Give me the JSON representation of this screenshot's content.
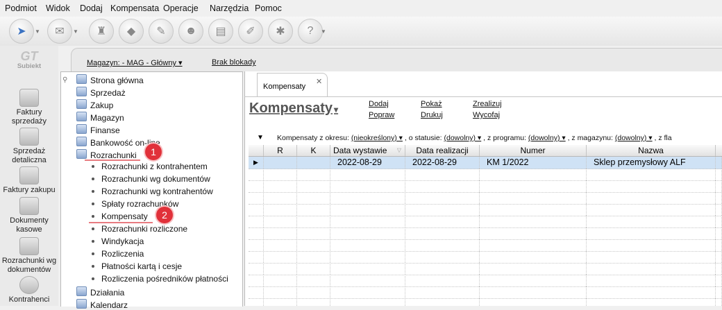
{
  "menu": [
    "Podmiot",
    "Widok",
    "Dodaj",
    "Kompensata",
    "Operacje",
    "Narzędzia",
    "Pomoc"
  ],
  "app_logo": "Subiekt",
  "left_nav": [
    {
      "label": "Faktury sprzedaży"
    },
    {
      "label": "Sprzedaż detaliczna"
    },
    {
      "label": "Faktury zakupu"
    },
    {
      "label": "Dokumenty kasowe"
    },
    {
      "label": "Rozrachunki wg dokumentów"
    },
    {
      "label": "Kontrahenci"
    }
  ],
  "header": {
    "warehouse": "Magazyn: - MAG - Główny ▾",
    "lock": "Brak blokady"
  },
  "tree": {
    "items": [
      {
        "label": "Strona główna",
        "level": 0
      },
      {
        "label": "Sprzedaż",
        "level": 0
      },
      {
        "label": "Zakup",
        "level": 0
      },
      {
        "label": "Magazyn",
        "level": 0
      },
      {
        "label": "Finanse",
        "level": 0
      },
      {
        "label": "Bankowość on-line",
        "level": 0
      },
      {
        "label": "Rozrachunki",
        "level": 0
      },
      {
        "label": "Rozrachunki z kontrahentem",
        "level": 1
      },
      {
        "label": "Rozrachunki wg dokumentów",
        "level": 1
      },
      {
        "label": "Rozrachunki wg kontrahentów",
        "level": 1
      },
      {
        "label": "Spłaty rozrachunków",
        "level": 1
      },
      {
        "label": "Kompensaty",
        "level": 1
      },
      {
        "label": "Rozrachunki rozliczone",
        "level": 1
      },
      {
        "label": "Windykacja",
        "level": 1
      },
      {
        "label": "Rozliczenia",
        "level": 1
      },
      {
        "label": "Płatności kartą i cesje",
        "level": 1
      },
      {
        "label": "Rozliczenia pośredników płatności",
        "level": 1
      },
      {
        "label": "Działania",
        "level": 0
      },
      {
        "label": "Kalendarz",
        "level": 0
      }
    ],
    "callouts": [
      "1",
      "2"
    ]
  },
  "tab": {
    "label": "Kompensaty",
    "close": "✕"
  },
  "page_title": "Kompensaty",
  "title_arrow": "▾",
  "actions": {
    "dodaj": "Dodaj",
    "popraw": "Popraw",
    "pokaz": "Pokaż",
    "drukuj": "Drukuj",
    "zrealizuj": "Zrealizuj",
    "wycofaj": "Wycofaj"
  },
  "filter": {
    "l1": "Kompensaty z okresu:",
    "v1": "(nieokreślony) ▾",
    "l2": ", o statusie:",
    "v2": "(dowolny) ▾",
    "l3": ", z programu:",
    "v3": "(dowolny) ▾",
    "l4": ", z magazynu:",
    "v4": "(dowolny) ▾",
    "l5": ", z fla"
  },
  "table": {
    "columns": [
      "R",
      "K",
      "Data wystawie",
      "Data realizacji",
      "Numer",
      "Nazwa"
    ],
    "rows": [
      {
        "data_wystawienia": "2022-08-29",
        "data_realizacji": "2022-08-29",
        "numer": "KM 1/2022",
        "nazwa": "Sklep przemysłowy ALF"
      }
    ]
  }
}
